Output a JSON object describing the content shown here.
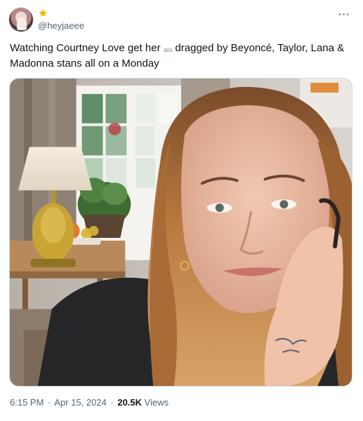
{
  "author": {
    "handle": "@heyjaeee",
    "badge_icon": "star-badge-icon"
  },
  "menu": {
    "more_label": "···"
  },
  "tweet": {
    "text_line1": "Watching Courtney Love get her ",
    "text_censored": "ass",
    "text_line1_rest": " dragged by Beyoncé, Taylor, Lana &",
    "text_line2": "Madonna stans all on a Monday"
  },
  "media": {
    "kind": "photo",
    "accent": "#f0a35a"
  },
  "meta": {
    "time": "6:15 PM",
    "dot1": "·",
    "date": "Apr 15, 2024",
    "dot2": "·",
    "views_count": "20.5K",
    "views_label": "Views"
  }
}
